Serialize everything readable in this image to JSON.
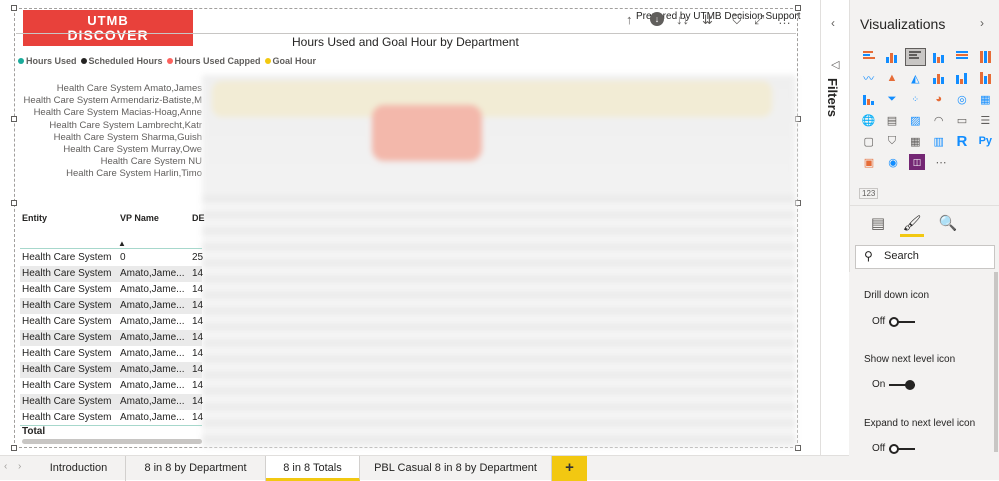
{
  "report": {
    "logo": {
      "line1": "UTMB",
      "line2": "DISCOVER"
    },
    "prepared_by": "Prepared by UTMB Decision Support",
    "chart": {
      "title": "Hours Used and Goal Hour by Department",
      "legend": [
        {
          "label": "Hours Used",
          "color": "#1aab9b"
        },
        {
          "label": "Scheduled Hours",
          "color": "#252423"
        },
        {
          "label": "Hours Used Capped",
          "color": "#fd625e"
        },
        {
          "label": "Goal Hour",
          "color": "#f2c80f"
        }
      ],
      "y_labels": [
        "Health Care System Amato,James",
        "Health Care System Armendariz-Batiste,M",
        "Health Care System Macias-Hoag,Anne",
        "Health Care System Lambrecht,Katr",
        "Health Care System Sharma,Guish",
        "Health Care System Murray,Owe",
        "Health Care System NU",
        "Health Care System Harlin,Timo"
      ]
    },
    "table": {
      "headers": {
        "entity": "Entity",
        "vp_name": "VP Name",
        "dept": "DE"
      },
      "rows": [
        {
          "entity": "Health Care System",
          "vp": "0",
          "dept": "25"
        },
        {
          "entity": "Health Care System",
          "vp": "Amato,Jame...",
          "dept": "14"
        },
        {
          "entity": "Health Care System",
          "vp": "Amato,Jame...",
          "dept": "14"
        },
        {
          "entity": "Health Care System",
          "vp": "Amato,Jame...",
          "dept": "14"
        },
        {
          "entity": "Health Care System",
          "vp": "Amato,Jame...",
          "dept": "14"
        },
        {
          "entity": "Health Care System",
          "vp": "Amato,Jame...",
          "dept": "14"
        },
        {
          "entity": "Health Care System",
          "vp": "Amato,Jame...",
          "dept": "14"
        },
        {
          "entity": "Health Care System",
          "vp": "Amato,Jame...",
          "dept": "14"
        },
        {
          "entity": "Health Care System",
          "vp": "Amato,Jame...",
          "dept": "14"
        },
        {
          "entity": "Health Care System",
          "vp": "Amato,Jame...",
          "dept": "14"
        },
        {
          "entity": "Health Care System",
          "vp": "Amato,Jame...",
          "dept": "14"
        }
      ],
      "total_label": "Total"
    }
  },
  "tabs": {
    "items": [
      "Introduction",
      "8 in 8 by Department",
      "8 in 8 Totals",
      "PBL Casual 8 in 8 by Department"
    ],
    "active": "8 in 8 Totals",
    "add": "+"
  },
  "filters": {
    "label": "Filters"
  },
  "visualizations": {
    "title": "Visualizations",
    "search_placeholder": "Search",
    "number_badge": "123",
    "settings": [
      {
        "label": "Drill down icon",
        "state": "Off"
      },
      {
        "label": "Show next level icon",
        "state": "On"
      },
      {
        "label": "Expand to next level icon",
        "state": "Off"
      }
    ]
  }
}
